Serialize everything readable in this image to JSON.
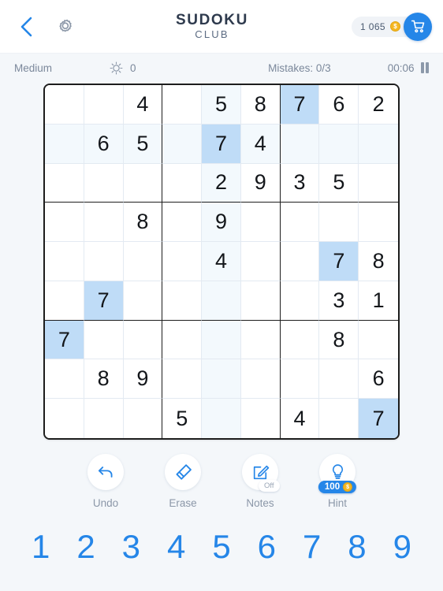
{
  "header": {
    "back_icon": "chevron-left-icon",
    "settings_icon": "gear-icon",
    "title_main": "SUDOKU",
    "title_sub": "CLUB",
    "coin_count": "1 065",
    "coin_symbol": "$",
    "coin_icon": "coin-icon",
    "cart_icon": "shopping-cart-icon"
  },
  "status": {
    "difficulty": "Medium",
    "star_icon": "sun-burst-icon",
    "star_count": "0",
    "mistakes": "Mistakes: 0/3",
    "time": "00:06",
    "pause_icon": "pause-icon"
  },
  "board": {
    "selected": {
      "row": 1,
      "col": 4
    },
    "highlight_number": "7",
    "colors": {
      "selected_bg": "#bfdcf7",
      "match_bg": "#bfdcf7",
      "peer_bg": "#f3f9fd",
      "grid_line": "#1d1d1d",
      "cell_line": "#e3eaf2",
      "digit": "#13161a"
    },
    "rows": [
      [
        "",
        "",
        "4",
        "",
        "5",
        "8",
        "7",
        "6",
        "2"
      ],
      [
        "",
        "6",
        "5",
        "",
        "7",
        "4",
        "",
        "",
        ""
      ],
      [
        "",
        "",
        "",
        "",
        "2",
        "9",
        "3",
        "5",
        ""
      ],
      [
        "",
        "",
        "8",
        "",
        "9",
        "",
        "",
        "",
        ""
      ],
      [
        "",
        "",
        "",
        "",
        "4",
        "",
        "",
        "7",
        "8"
      ],
      [
        "",
        "7",
        "",
        "",
        "",
        "",
        "",
        "3",
        "1"
      ],
      [
        "7",
        "",
        "",
        "",
        "",
        "",
        "",
        "8",
        ""
      ],
      [
        "",
        "8",
        "9",
        "",
        "",
        "",
        "",
        "",
        "6"
      ],
      [
        "",
        "",
        "",
        "5",
        "",
        "",
        "4",
        "",
        "7"
      ]
    ]
  },
  "actions": [
    {
      "name": "undo",
      "label": "Undo",
      "icon": "undo-arrow-icon"
    },
    {
      "name": "erase",
      "label": "Erase",
      "icon": "eraser-icon"
    },
    {
      "name": "notes",
      "label": "Notes",
      "icon": "pencil-note-icon",
      "toggle": "Off"
    },
    {
      "name": "hint",
      "label": "Hint",
      "icon": "lightbulb-icon",
      "badge": "100",
      "badge_coin": "$"
    }
  ],
  "numpad": [
    "1",
    "2",
    "3",
    "4",
    "5",
    "6",
    "7",
    "8",
    "9"
  ]
}
